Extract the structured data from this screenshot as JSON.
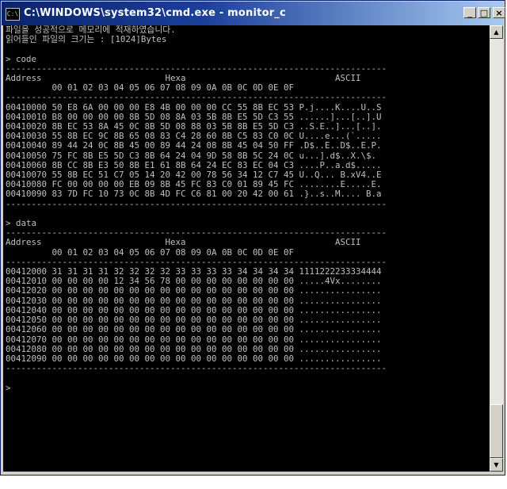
{
  "window": {
    "title": "C:\\WINDOWS\\system32\\cmd.exe - monitor_c",
    "icon_text": "C:\\",
    "minimize": "_",
    "maximize": "□",
    "close": "×"
  },
  "console": {
    "lines": [
      "파일을 성공적으로 메모리에 적재하였습니다.",
      "읽어들인 파일의 크기는 : [1024]Bytes",
      "",
      "> code",
      "--------------------------------------------------------------------------",
      "Address                        Hexa                             ASCII",
      "         00 01 02 03 04 05 06 07 08 09 0A 0B 0C 0D 0E 0F",
      "--------------------------------------------------------------------------",
      "00410000 50 E8 6A 00 00 00 E8 4B 00 00 00 CC 55 8B EC 53 P.j....K....U..S",
      "00410010 B8 00 00 00 00 8B 5D 08 8A 03 5B 8B E5 5D C3 55 ......]...[..].U",
      "00410020 8B EC 53 8A 45 0C 8B 5D 08 88 03 5B 8B E5 5D C3 ..S.E..]...[..].",
      "00410030 55 8B EC 9C 8B 65 08 83 C4 28 60 8B C5 83 C0 0C U....e...(`.....",
      "00410040 89 44 24 0C 8B 45 00 89 44 24 08 8B 45 04 50 FF .D$..E..D$..E.P.",
      "00410050 75 FC 8B E5 5D C3 8B 64 24 04 9D 58 8B 5C 24 0C u...].d$..X.\\$.",
      "00410060 8B CC 8B E3 50 8B E1 61 8B 64 24 EC 83 EC 04 C3 ....P..a.d$.....",
      "00410070 55 8B EC 51 C7 05 14 20 42 00 78 56 34 12 C7 45 U..Q... B.xV4..E",
      "00410080 FC 00 00 00 00 EB 09 8B 45 FC 83 C0 01 89 45 FC ........E.....E.",
      "00410090 83 7D FC 10 73 0C 8B 4D FC C6 81 00 20 42 00 61 .}..s..M.... B.a",
      "--------------------------------------------------------------------------",
      "",
      "> data",
      "--------------------------------------------------------------------------",
      "Address                        Hexa                             ASCII",
      "         00 01 02 03 04 05 06 07 08 09 0A 0B 0C 0D 0E 0F",
      "--------------------------------------------------------------------------",
      "00412000 31 31 31 31 32 32 32 32 33 33 33 33 34 34 34 34 1111222233334444",
      "00412010 00 00 00 00 12 34 56 78 00 00 00 00 00 00 00 00 .....4Vx........",
      "00412020 00 00 00 00 00 00 00 00 00 00 00 00 00 00 00 00 ................",
      "00412030 00 00 00 00 00 00 00 00 00 00 00 00 00 00 00 00 ................",
      "00412040 00 00 00 00 00 00 00 00 00 00 00 00 00 00 00 00 ................",
      "00412050 00 00 00 00 00 00 00 00 00 00 00 00 00 00 00 00 ................",
      "00412060 00 00 00 00 00 00 00 00 00 00 00 00 00 00 00 00 ................",
      "00412070 00 00 00 00 00 00 00 00 00 00 00 00 00 00 00 00 ................",
      "00412080 00 00 00 00 00 00 00 00 00 00 00 00 00 00 00 00 ................",
      "00412090 00 00 00 00 00 00 00 00 00 00 00 00 00 00 00 00 ................",
      "--------------------------------------------------------------------------",
      "",
      ">"
    ]
  },
  "scrollbar": {
    "up_arrow": "▲",
    "down_arrow": "▼"
  },
  "colors": {
    "console_bg": "#000000",
    "console_text": "#c0c0c0",
    "titlebar_start": "#0a246a",
    "titlebar_end": "#a6caf0"
  }
}
